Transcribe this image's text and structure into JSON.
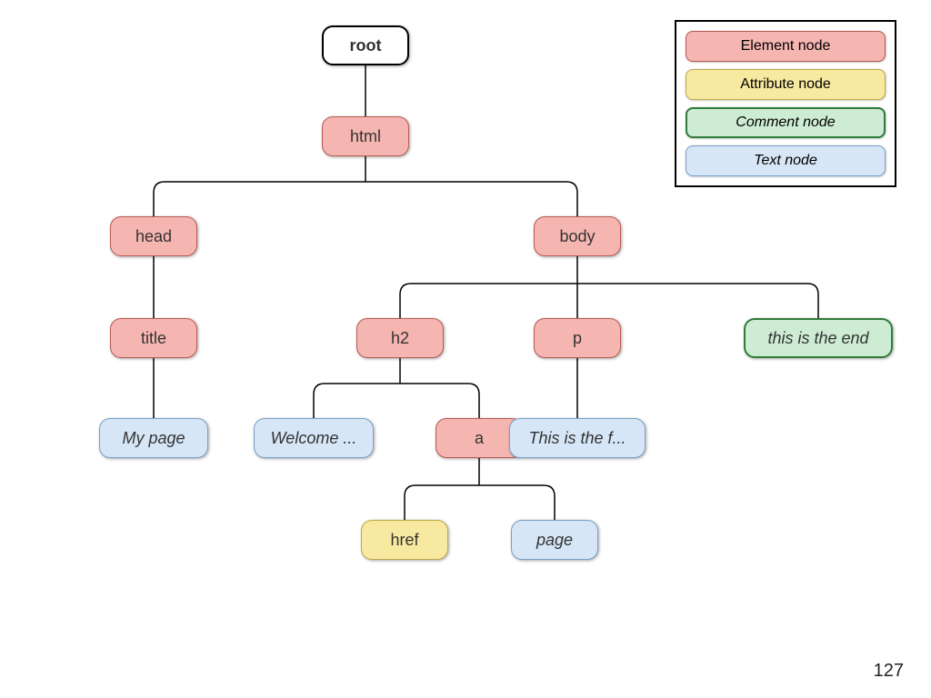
{
  "page_number": "127",
  "legend": {
    "element": "Element node",
    "attribute": "Attribute node",
    "comment": "Comment node",
    "text": "Text node"
  },
  "nodes": {
    "root": {
      "label": "root",
      "kind": "root"
    },
    "html": {
      "label": "html",
      "kind": "element"
    },
    "head": {
      "label": "head",
      "kind": "element"
    },
    "body": {
      "label": "body",
      "kind": "element"
    },
    "title": {
      "label": "title",
      "kind": "element"
    },
    "h2": {
      "label": "h2",
      "kind": "element"
    },
    "p": {
      "label": "p",
      "kind": "element"
    },
    "end": {
      "label": "this is the end",
      "kind": "comment"
    },
    "mypage": {
      "label": "My page",
      "kind": "text"
    },
    "welcome": {
      "label": "Welcome ...",
      "kind": "text"
    },
    "a": {
      "label": "a",
      "kind": "element"
    },
    "thisisf": {
      "label": "This is the f...",
      "kind": "text"
    },
    "href": {
      "label": "href",
      "kind": "attribute"
    },
    "page": {
      "label": "page",
      "kind": "text"
    }
  },
  "tree": {
    "root": [
      "html"
    ],
    "html": [
      "head",
      "body"
    ],
    "head": [
      "title"
    ],
    "body": [
      "h2",
      "p",
      "end"
    ],
    "title": [
      "mypage"
    ],
    "h2": [
      "welcome",
      "a"
    ],
    "p": [
      "thisisf"
    ],
    "a": [
      "href",
      "page"
    ]
  },
  "colors": {
    "element": "#f5b5b1",
    "attribute": "#f7e9a0",
    "comment": "#cdecd3",
    "text": "#d6e6f7",
    "root": "#ffffff"
  }
}
